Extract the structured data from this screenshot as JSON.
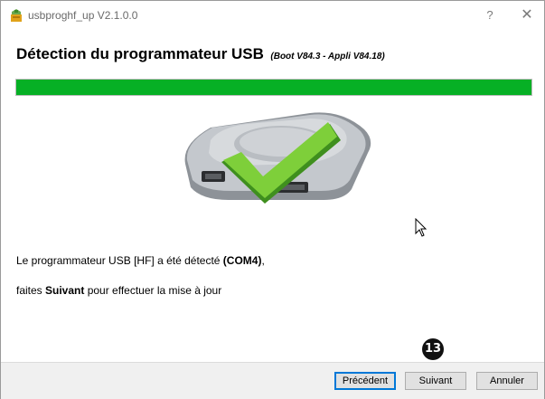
{
  "window": {
    "title": "usbproghf_up V2.1.0.0",
    "help_label": "?",
    "close_label": "✕"
  },
  "header": {
    "title": "Détection du programmateur USB",
    "subtitle": "(Boot V84.3 - Appli V84.18)"
  },
  "progress": {
    "percent": 100,
    "color": "#06b025"
  },
  "illustration": {
    "device_icon": "usb-programmer-icon",
    "status_icon": "checkmark-icon",
    "check_color": "#5cb82a"
  },
  "message": {
    "line1_prefix": "Le programmateur USB ",
    "line1_device": "[HF]",
    "line1_middle": " a été détecté ",
    "line1_port": "(COM4)",
    "line1_suffix": ",",
    "line2_prefix": "faites ",
    "line2_action": "Suivant",
    "line2_suffix": " pour effectuer la mise à jour"
  },
  "step_badge": "13",
  "buttons": {
    "previous": "Précédent",
    "next": "Suivant",
    "cancel": "Annuler"
  }
}
